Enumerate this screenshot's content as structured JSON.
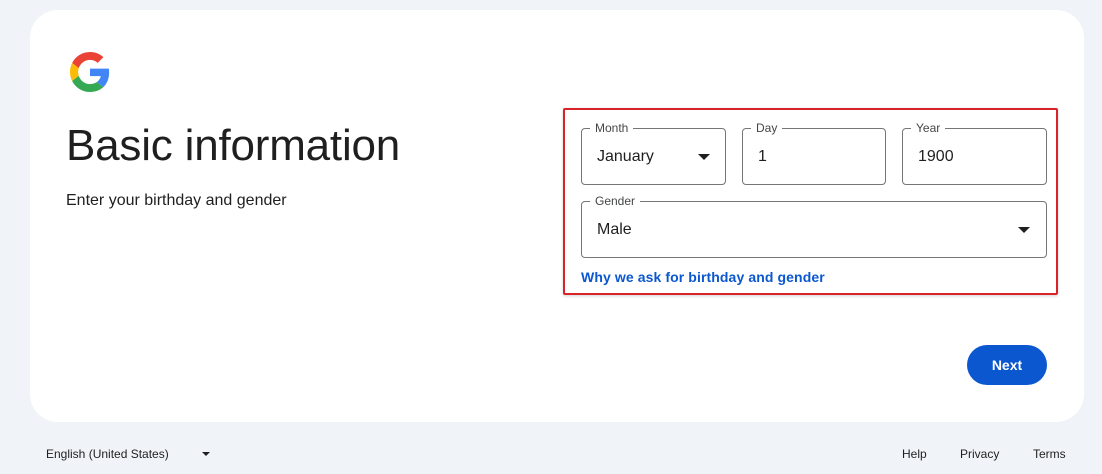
{
  "logo": {
    "icon": "google-g-logo",
    "colors": [
      "#4285F4",
      "#EA4335",
      "#FBBC05",
      "#34A853"
    ]
  },
  "header": {
    "title": "Basic information",
    "subtitle": "Enter your birthday and gender"
  },
  "birthday": {
    "month": {
      "label": "Month",
      "value": "January",
      "icon": "dropdown-arrow-icon"
    },
    "day": {
      "label": "Day",
      "value": "1"
    },
    "year": {
      "label": "Year",
      "value": "1900"
    }
  },
  "gender": {
    "label": "Gender",
    "value": "Male",
    "icon": "dropdown-arrow-icon"
  },
  "why_link": "Why we ask for birthday and gender",
  "next_button": "Next",
  "footer": {
    "language": "English (United States)",
    "help": "Help",
    "privacy": "Privacy",
    "terms": "Terms"
  },
  "colors": {
    "accent": "#0b57d0",
    "highlight_border": "#d9222a",
    "background": "#f0f4f9"
  }
}
